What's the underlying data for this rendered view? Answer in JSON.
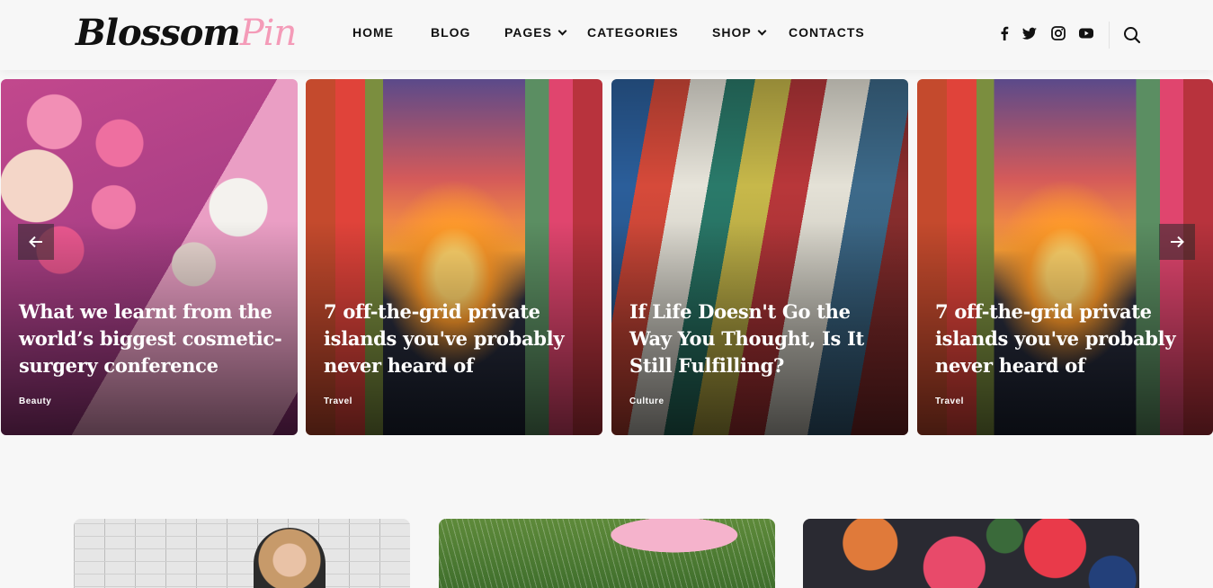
{
  "brand": {
    "logo_part1": "Blossom",
    "logo_part2": "Pin",
    "accent": "#f49bb8"
  },
  "nav": {
    "items": [
      {
        "label": "HOME",
        "has_dropdown": false
      },
      {
        "label": "BLOG",
        "has_dropdown": false
      },
      {
        "label": "PAGES",
        "has_dropdown": true
      },
      {
        "label": "CATEGORIES",
        "has_dropdown": false
      },
      {
        "label": "SHOP",
        "has_dropdown": true
      },
      {
        "label": "CONTACTS",
        "has_dropdown": false
      }
    ]
  },
  "social": [
    "facebook-icon",
    "twitter-icon",
    "instagram-icon",
    "youtube-icon"
  ],
  "slider": {
    "slides": [
      {
        "title": "What we learnt from the world’s biggest cosmetic-surgery conference",
        "category": "Beauty"
      },
      {
        "title": "7 off-the-grid private islands you've probably never heard of",
        "category": "Travel"
      },
      {
        "title": "If Life Doesn't Go the Way You Thought, Is It Still Fulfilling?",
        "category": "Culture"
      },
      {
        "title": "7 off-the-grid private islands you've probably never heard of",
        "category": "Travel"
      }
    ]
  }
}
